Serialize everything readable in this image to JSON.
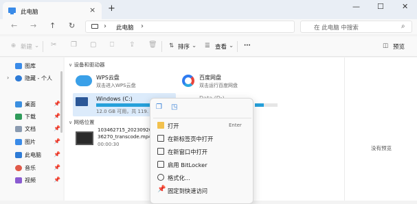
{
  "window": {
    "tab_title": "此电脑",
    "tab_close": "×",
    "new_tab": "+",
    "minimize": "—",
    "maximize": "☐",
    "close": "✕"
  },
  "nav": {
    "back": "←",
    "forward": "→",
    "up": "↑",
    "refresh": "↻",
    "chevron": "›",
    "breadcrumb": "此电脑",
    "search_placeholder": "在 此电脑 中搜索"
  },
  "toolbar": {
    "new_label": "新建",
    "sort_label": "排序",
    "view_label": "查看",
    "more_label": "···",
    "preview_label": "预览"
  },
  "sidebar": {
    "items": [
      {
        "label": "图库",
        "icon": "gallery-icon",
        "color": "#3a8be8",
        "chevron": "",
        "pin": ""
      },
      {
        "label": "隐藏 - 个人",
        "icon": "cloud-icon",
        "color": "#2e7bd6",
        "chevron": "›",
        "pin": ""
      },
      {
        "label": "桌面",
        "icon": "desktop-icon",
        "color": "#3b8fe0",
        "chevron": "",
        "pin": "📌"
      },
      {
        "label": "下载",
        "icon": "download-icon",
        "color": "#2f9b5a",
        "chevron": "",
        "pin": "📌"
      },
      {
        "label": "文档",
        "icon": "documents-icon",
        "color": "#8b9bb0",
        "chevron": "",
        "pin": "📌"
      },
      {
        "label": "图片",
        "icon": "pictures-icon",
        "color": "#3a8be8",
        "chevron": "",
        "pin": "📌"
      },
      {
        "label": "此电脑",
        "icon": "computer-icon",
        "color": "#2e7bd6",
        "chevron": "",
        "pin": "📌"
      },
      {
        "label": "音乐",
        "icon": "music-icon",
        "color": "#e05a4a",
        "chevron": "",
        "pin": "📌"
      },
      {
        "label": "视频",
        "icon": "videos-icon",
        "color": "#8a5bd1",
        "chevron": "",
        "pin": "📌"
      }
    ]
  },
  "content": {
    "devices_section": "设备和驱动器",
    "network_section": "网络位置",
    "section_chevron": "∨",
    "wps": {
      "name": "WPS云盘",
      "sub": "双击进入WPS云盘"
    },
    "baidu": {
      "name": "百度网盘",
      "sub": "双击运行百度网盘"
    },
    "drive_c": {
      "name": "Windows (C:)",
      "sub": "12.0 GB 可用，共 119.",
      "fill": 0.9
    },
    "drive_d": {
      "name": "Data (D:)",
      "fill": 0.4
    },
    "video": {
      "line1": "103462715_20230920",
      "line2": "36270_transcode.mp4",
      "line3": "00:00:30"
    }
  },
  "preview": {
    "empty": "没有预览"
  },
  "context_menu": {
    "items": [
      {
        "label": "打开",
        "shortcut": "Enter",
        "icon": "folder-open-icon"
      },
      {
        "label": "在新标签页中打开",
        "shortcut": "",
        "icon": "new-tab-icon"
      },
      {
        "label": "在新窗口中打开",
        "shortcut": "",
        "icon": "new-window-icon"
      },
      {
        "label": "启用 BitLocker",
        "shortcut": "",
        "icon": "bitlocker-icon"
      },
      {
        "label": "格式化...",
        "shortcut": "",
        "icon": "format-icon"
      },
      {
        "label": "固定到快速访问",
        "shortcut": "",
        "icon": "pin-icon"
      }
    ]
  },
  "colors": {
    "accent": "#3a8be8",
    "progress": "#26a0da",
    "pin": "#1565c0"
  }
}
